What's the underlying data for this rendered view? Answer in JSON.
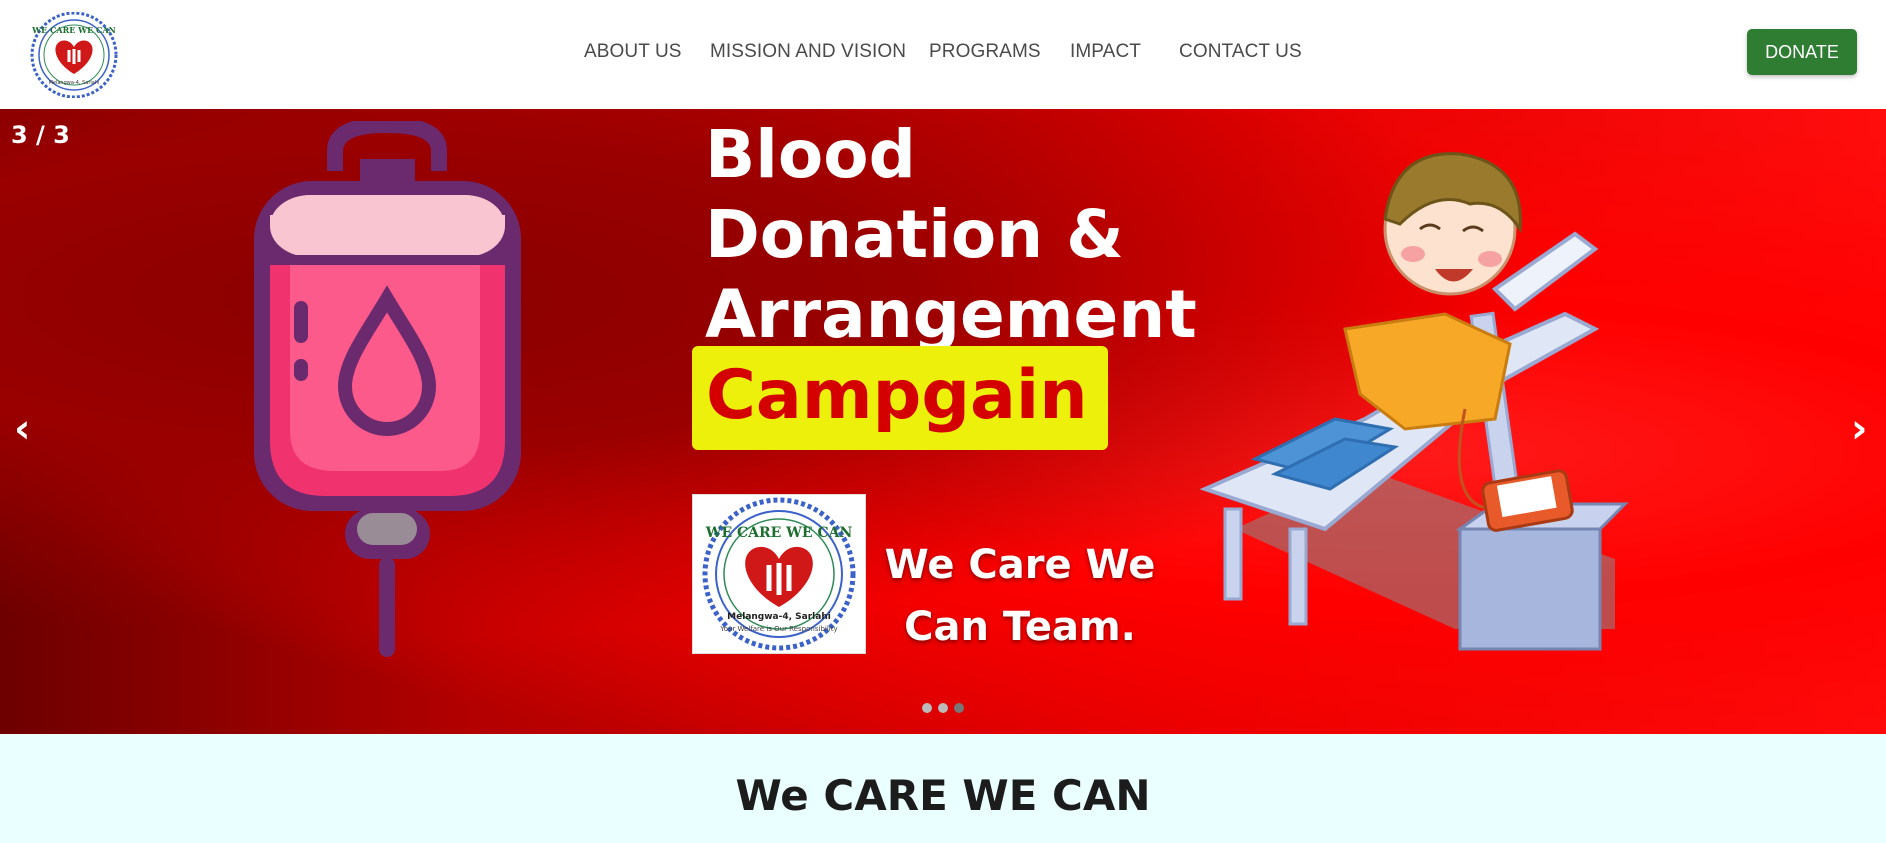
{
  "nav": {
    "items": [
      "ABOUT US",
      "MISSION AND VISION",
      "PROGRAMS",
      "IMPACT",
      "CONTACT US"
    ],
    "donate_label": "DONATE"
  },
  "hero": {
    "counter": "3 / 3",
    "prev_arrow": "‹",
    "next_arrow": "›",
    "title_lines": [
      "Blood",
      "Donation &",
      "Arrangement"
    ],
    "highlight": "Campgain",
    "team_lines": [
      "We Care We",
      "Can Team."
    ],
    "slides": 3,
    "active_slide": 3
  },
  "logo": {
    "text_top": "WE CARE WE CAN",
    "text_bottom": "Melangwa-4, Sarlahi",
    "text_motto": "Your Welfare is Our Responsibility"
  },
  "section": {
    "title": "We CARE WE CAN"
  },
  "colors": {
    "donate": "#2e7d32",
    "highlight_bg": "#ecf00a",
    "highlight_text": "#d40000",
    "section_bg": "#eaffff"
  }
}
